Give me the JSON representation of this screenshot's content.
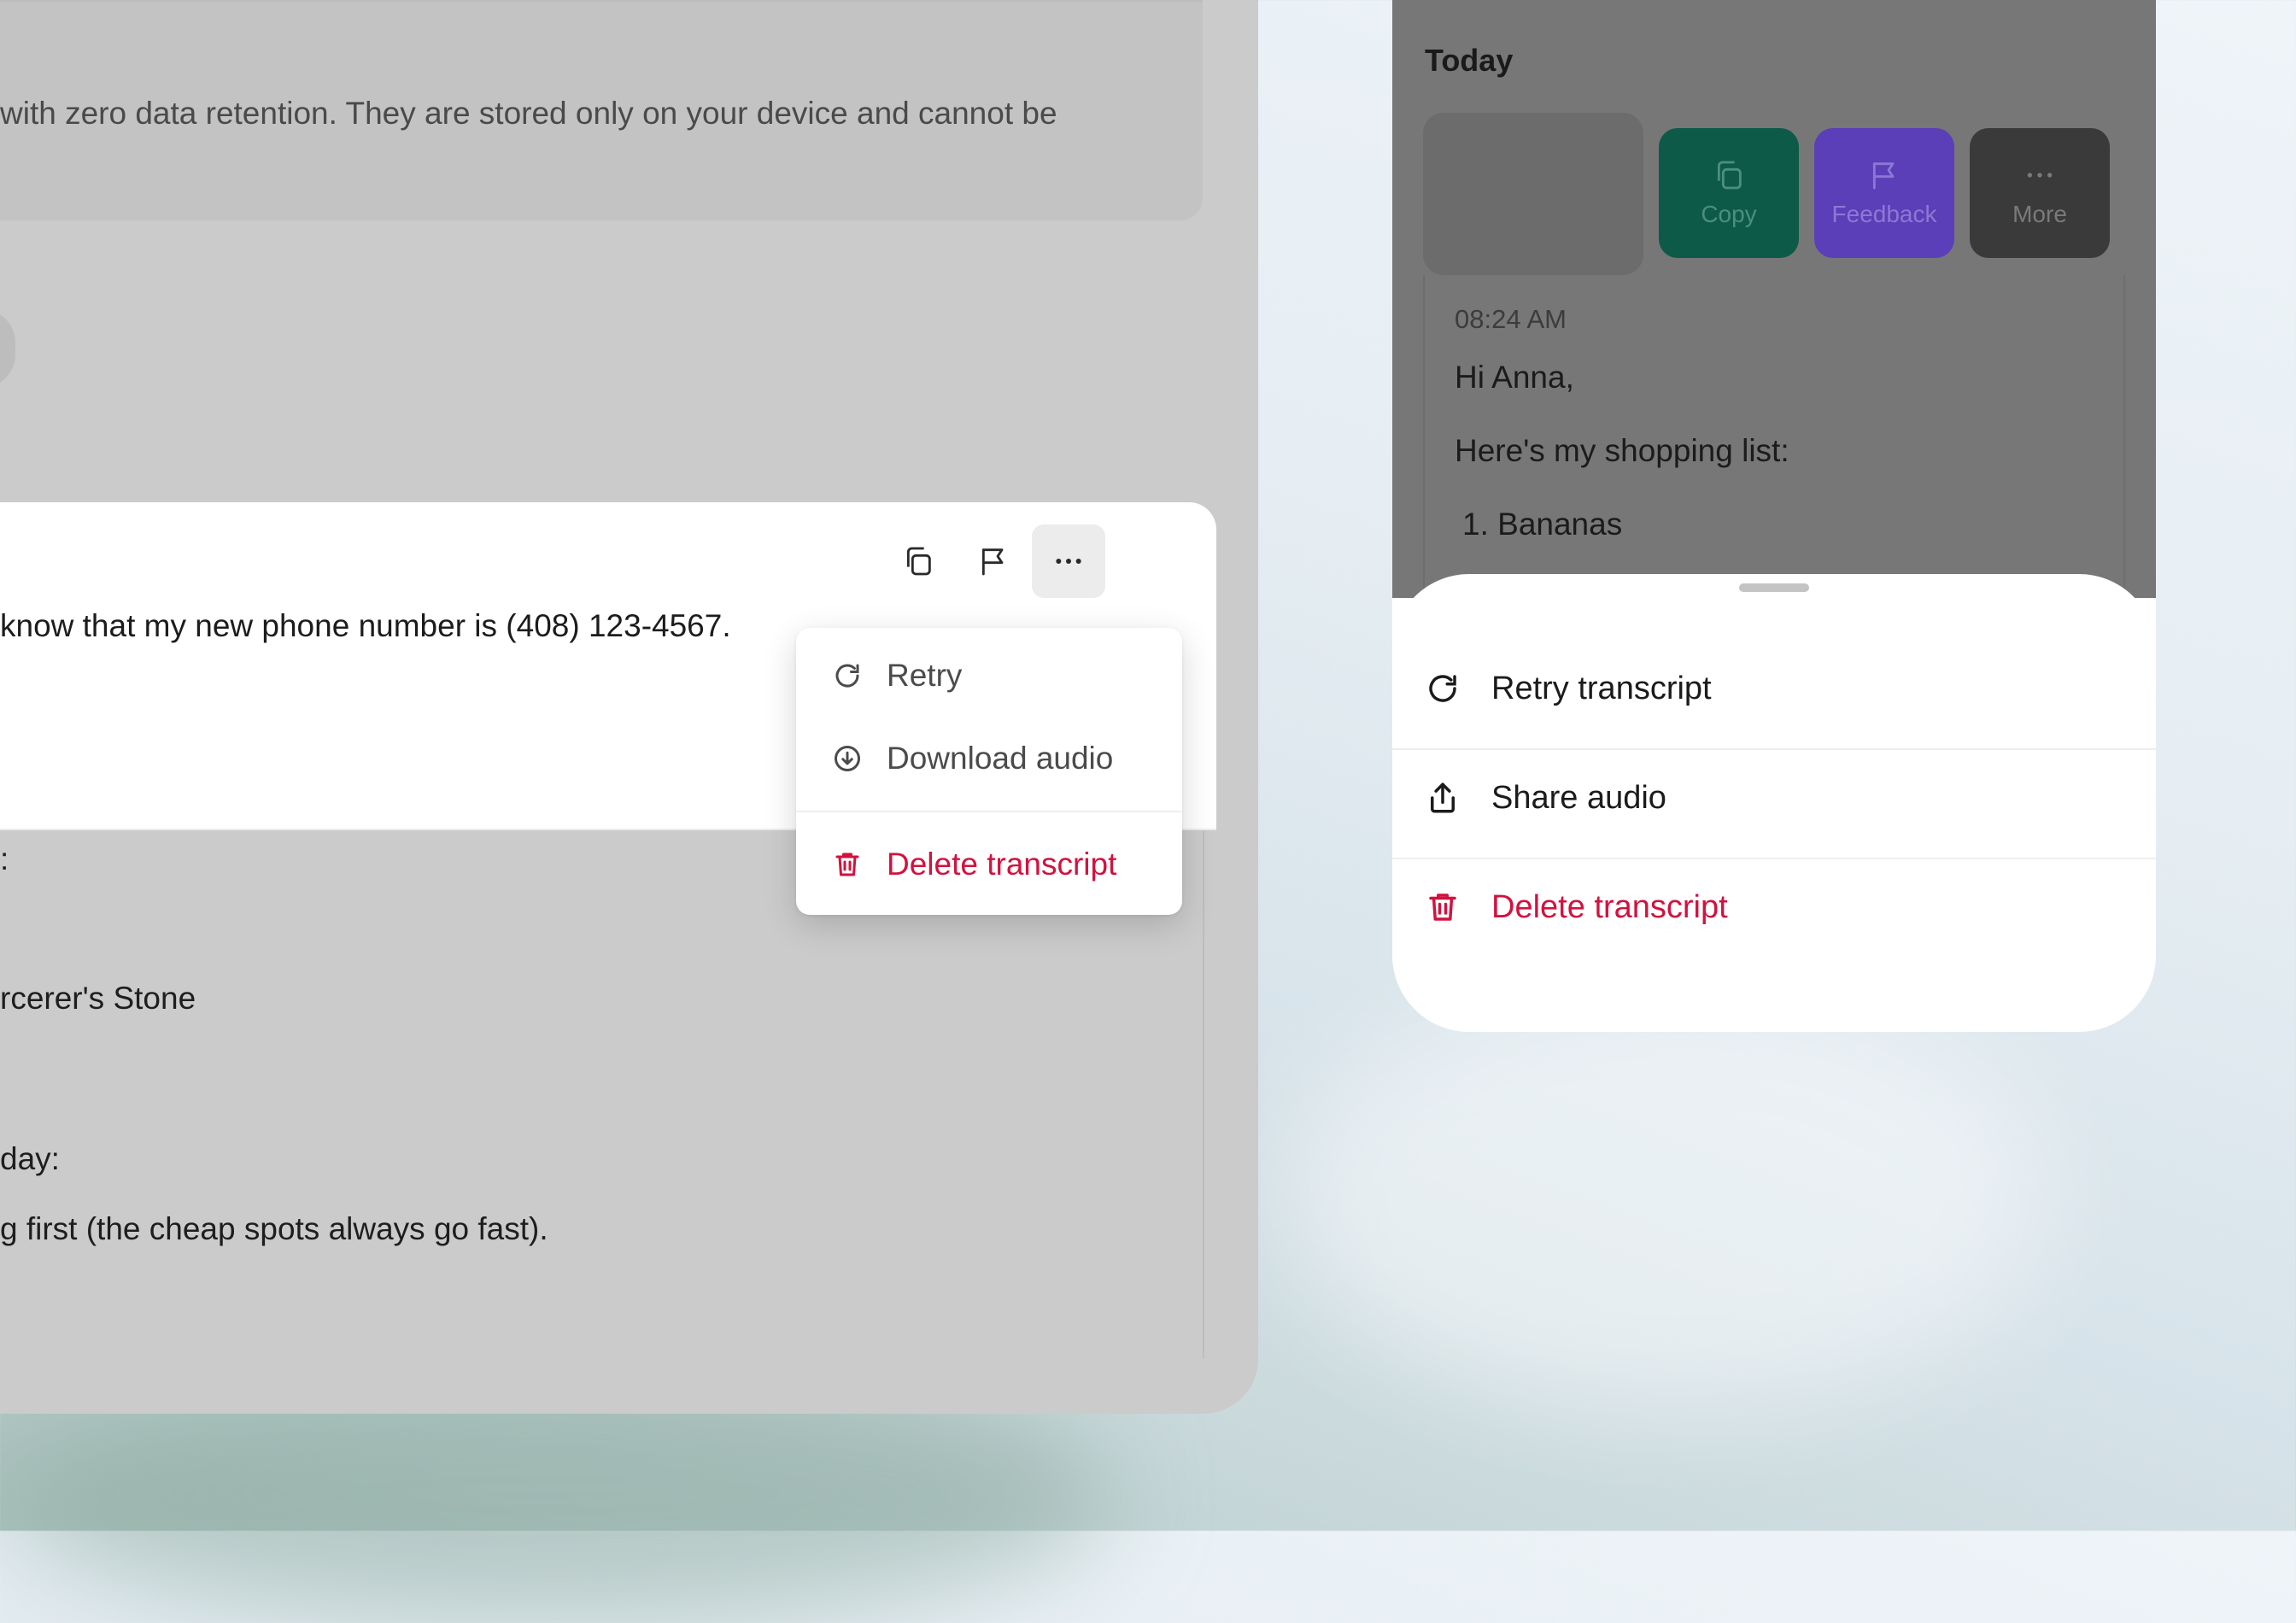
{
  "desktop": {
    "notice_text": "with zero data retention. They are stored only on your device and cannot be",
    "entry_text": "know that my new phone number is (408) 123-4567.",
    "background_lines": [
      ":",
      "rcerer's Stone",
      "day:",
      "g first (the cheap spots always go fast)."
    ],
    "menu": {
      "retry": "Retry",
      "download": "Download audio",
      "delete": "Delete transcript"
    }
  },
  "mobile": {
    "section_label": "Today",
    "actions": {
      "copy": "Copy",
      "feedback": "Feedback",
      "more": "More"
    },
    "time": "08:24 AM",
    "greeting": "Hi Anna,",
    "line2": "Here's my shopping list:",
    "list_item_1": "1. Bananas",
    "sheet": {
      "retry": "Retry transcript",
      "share": "Share audio",
      "delete": "Delete transcript"
    }
  },
  "colors": {
    "danger": "#d1123f",
    "copy_tile": "#0e5a48",
    "feedback_tile": "#5a3fb8",
    "more_tile": "#3a3a3a"
  }
}
